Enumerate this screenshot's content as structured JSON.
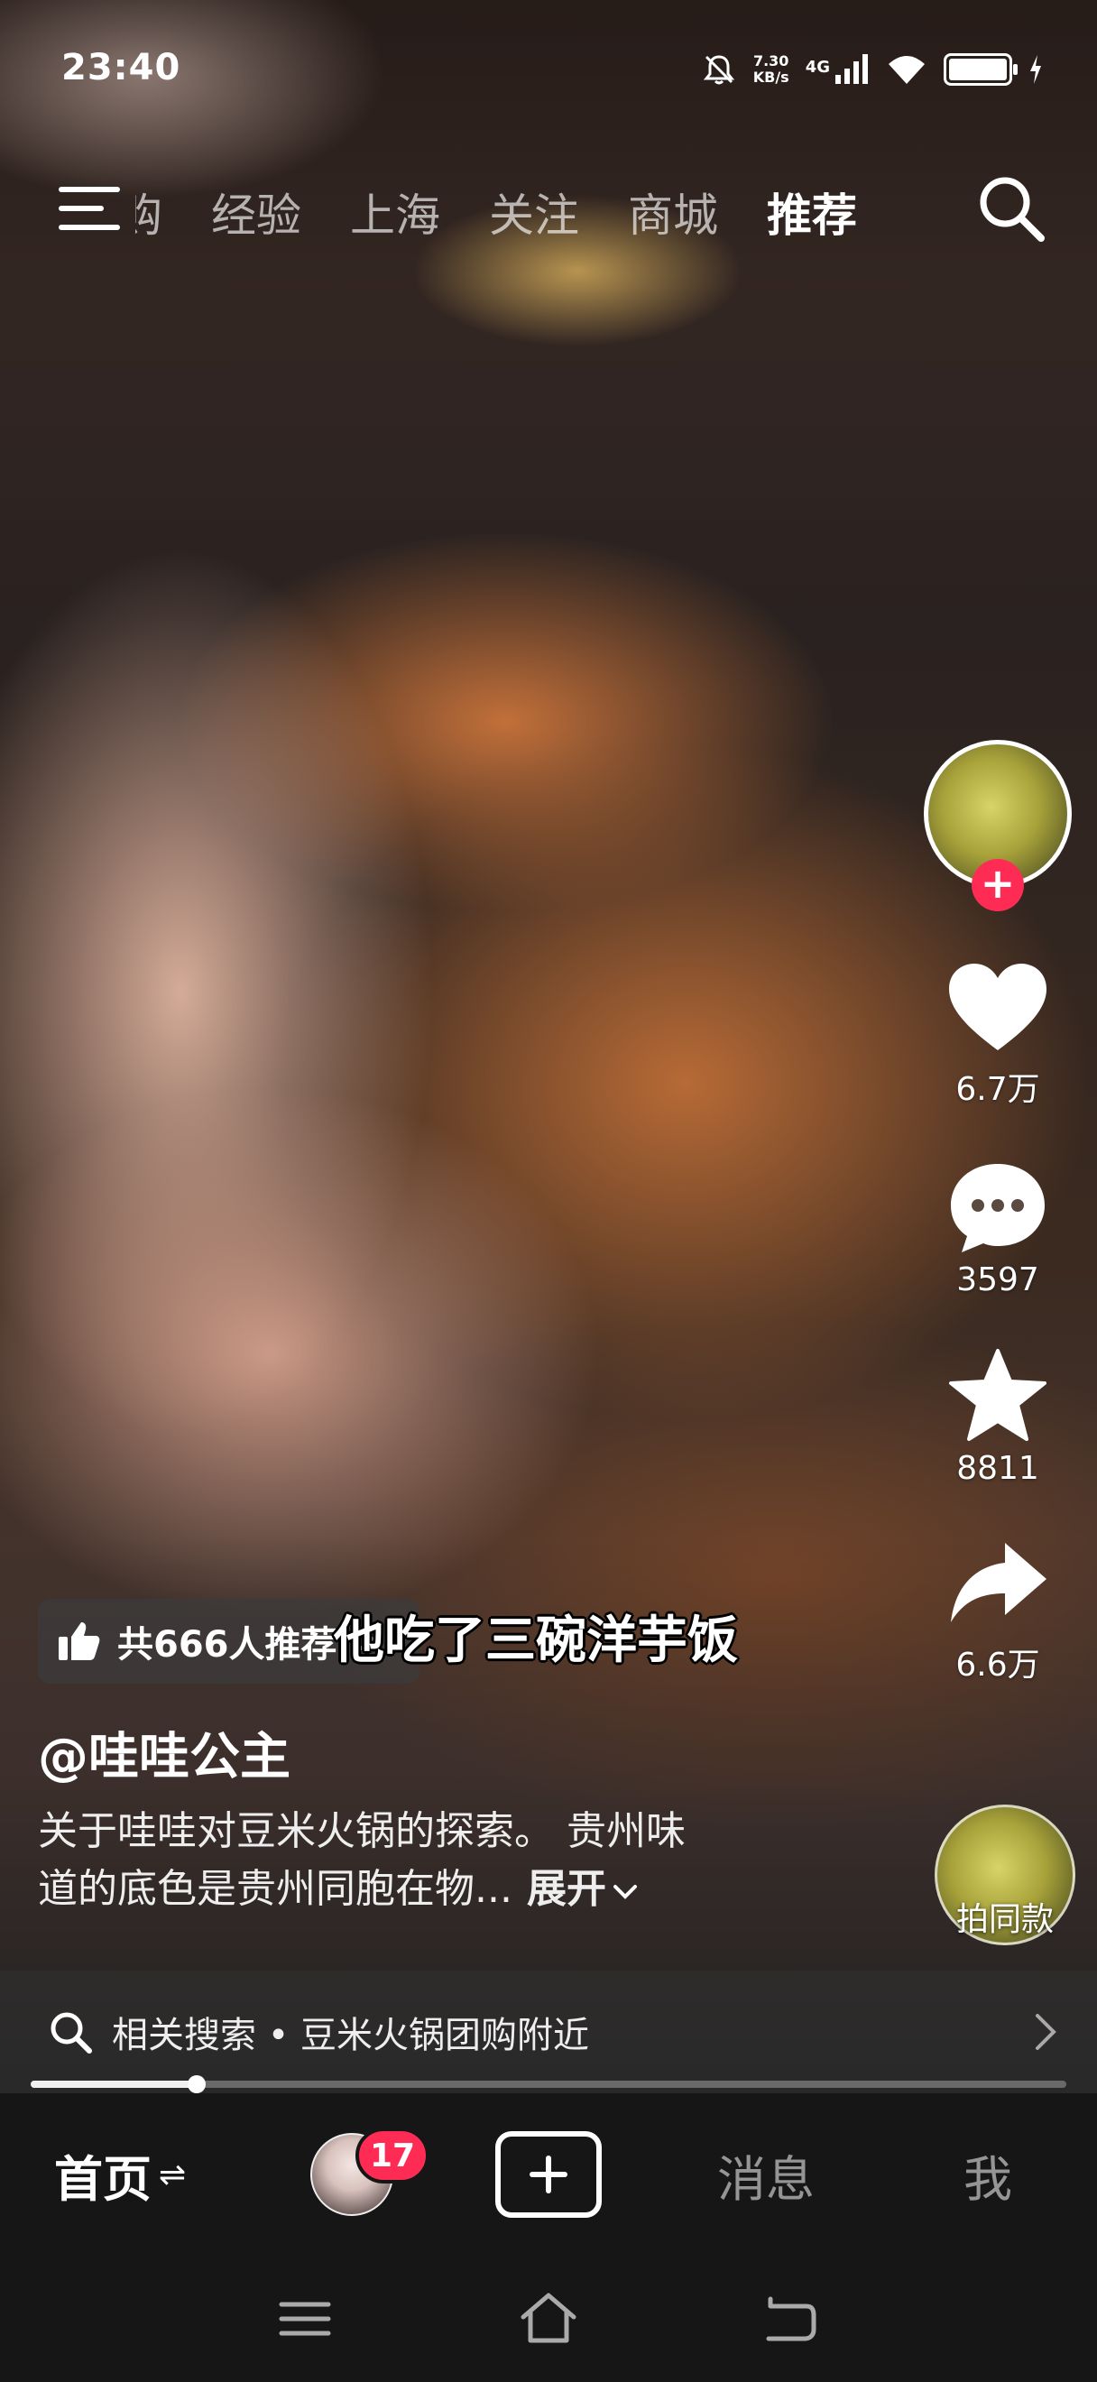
{
  "status_bar": {
    "time": "23:40",
    "net_speed_value": "7.30",
    "net_speed_unit": "KB/s",
    "network_type": "4G"
  },
  "top_nav": {
    "tabs": [
      {
        "label": "购"
      },
      {
        "label": "经验"
      },
      {
        "label": "上海"
      },
      {
        "label": "关注"
      },
      {
        "label": "商城"
      },
      {
        "label": "推荐",
        "active": true
      }
    ]
  },
  "video": {
    "subtitle": "他吃了三碗洋芋饭",
    "recommend_text": "共666人推荐",
    "recommend_arrow": ">",
    "author": "@哇哇公主",
    "description_line1": "关于哇哇对豆米火锅的探索。 贵州味",
    "description_line2": "道的底色是贵州同胞在物...",
    "expand_label": "展开",
    "progress_fraction": 0.16
  },
  "right_rail": {
    "follow_label": "+",
    "likes": "6.7万",
    "comments": "3597",
    "favorites": "8811",
    "shares": "6.6万",
    "same_style_label": "拍同款"
  },
  "related_search": {
    "text": "相关搜索 • 豆米火锅团购附近"
  },
  "bottom_tabs": {
    "home": "首页",
    "home_indicator": "⇌",
    "friends_badge": "17",
    "messages": "消息",
    "me": "我"
  },
  "colors": {
    "accent": "#fe2c55",
    "tab_bar_bg": "#161616"
  },
  "icons": [
    "menu-icon",
    "search-icon",
    "heart-icon",
    "comment-icon",
    "star-icon",
    "share-icon",
    "thumb-up-icon",
    "plus-icon",
    "chevron-right-icon"
  ]
}
